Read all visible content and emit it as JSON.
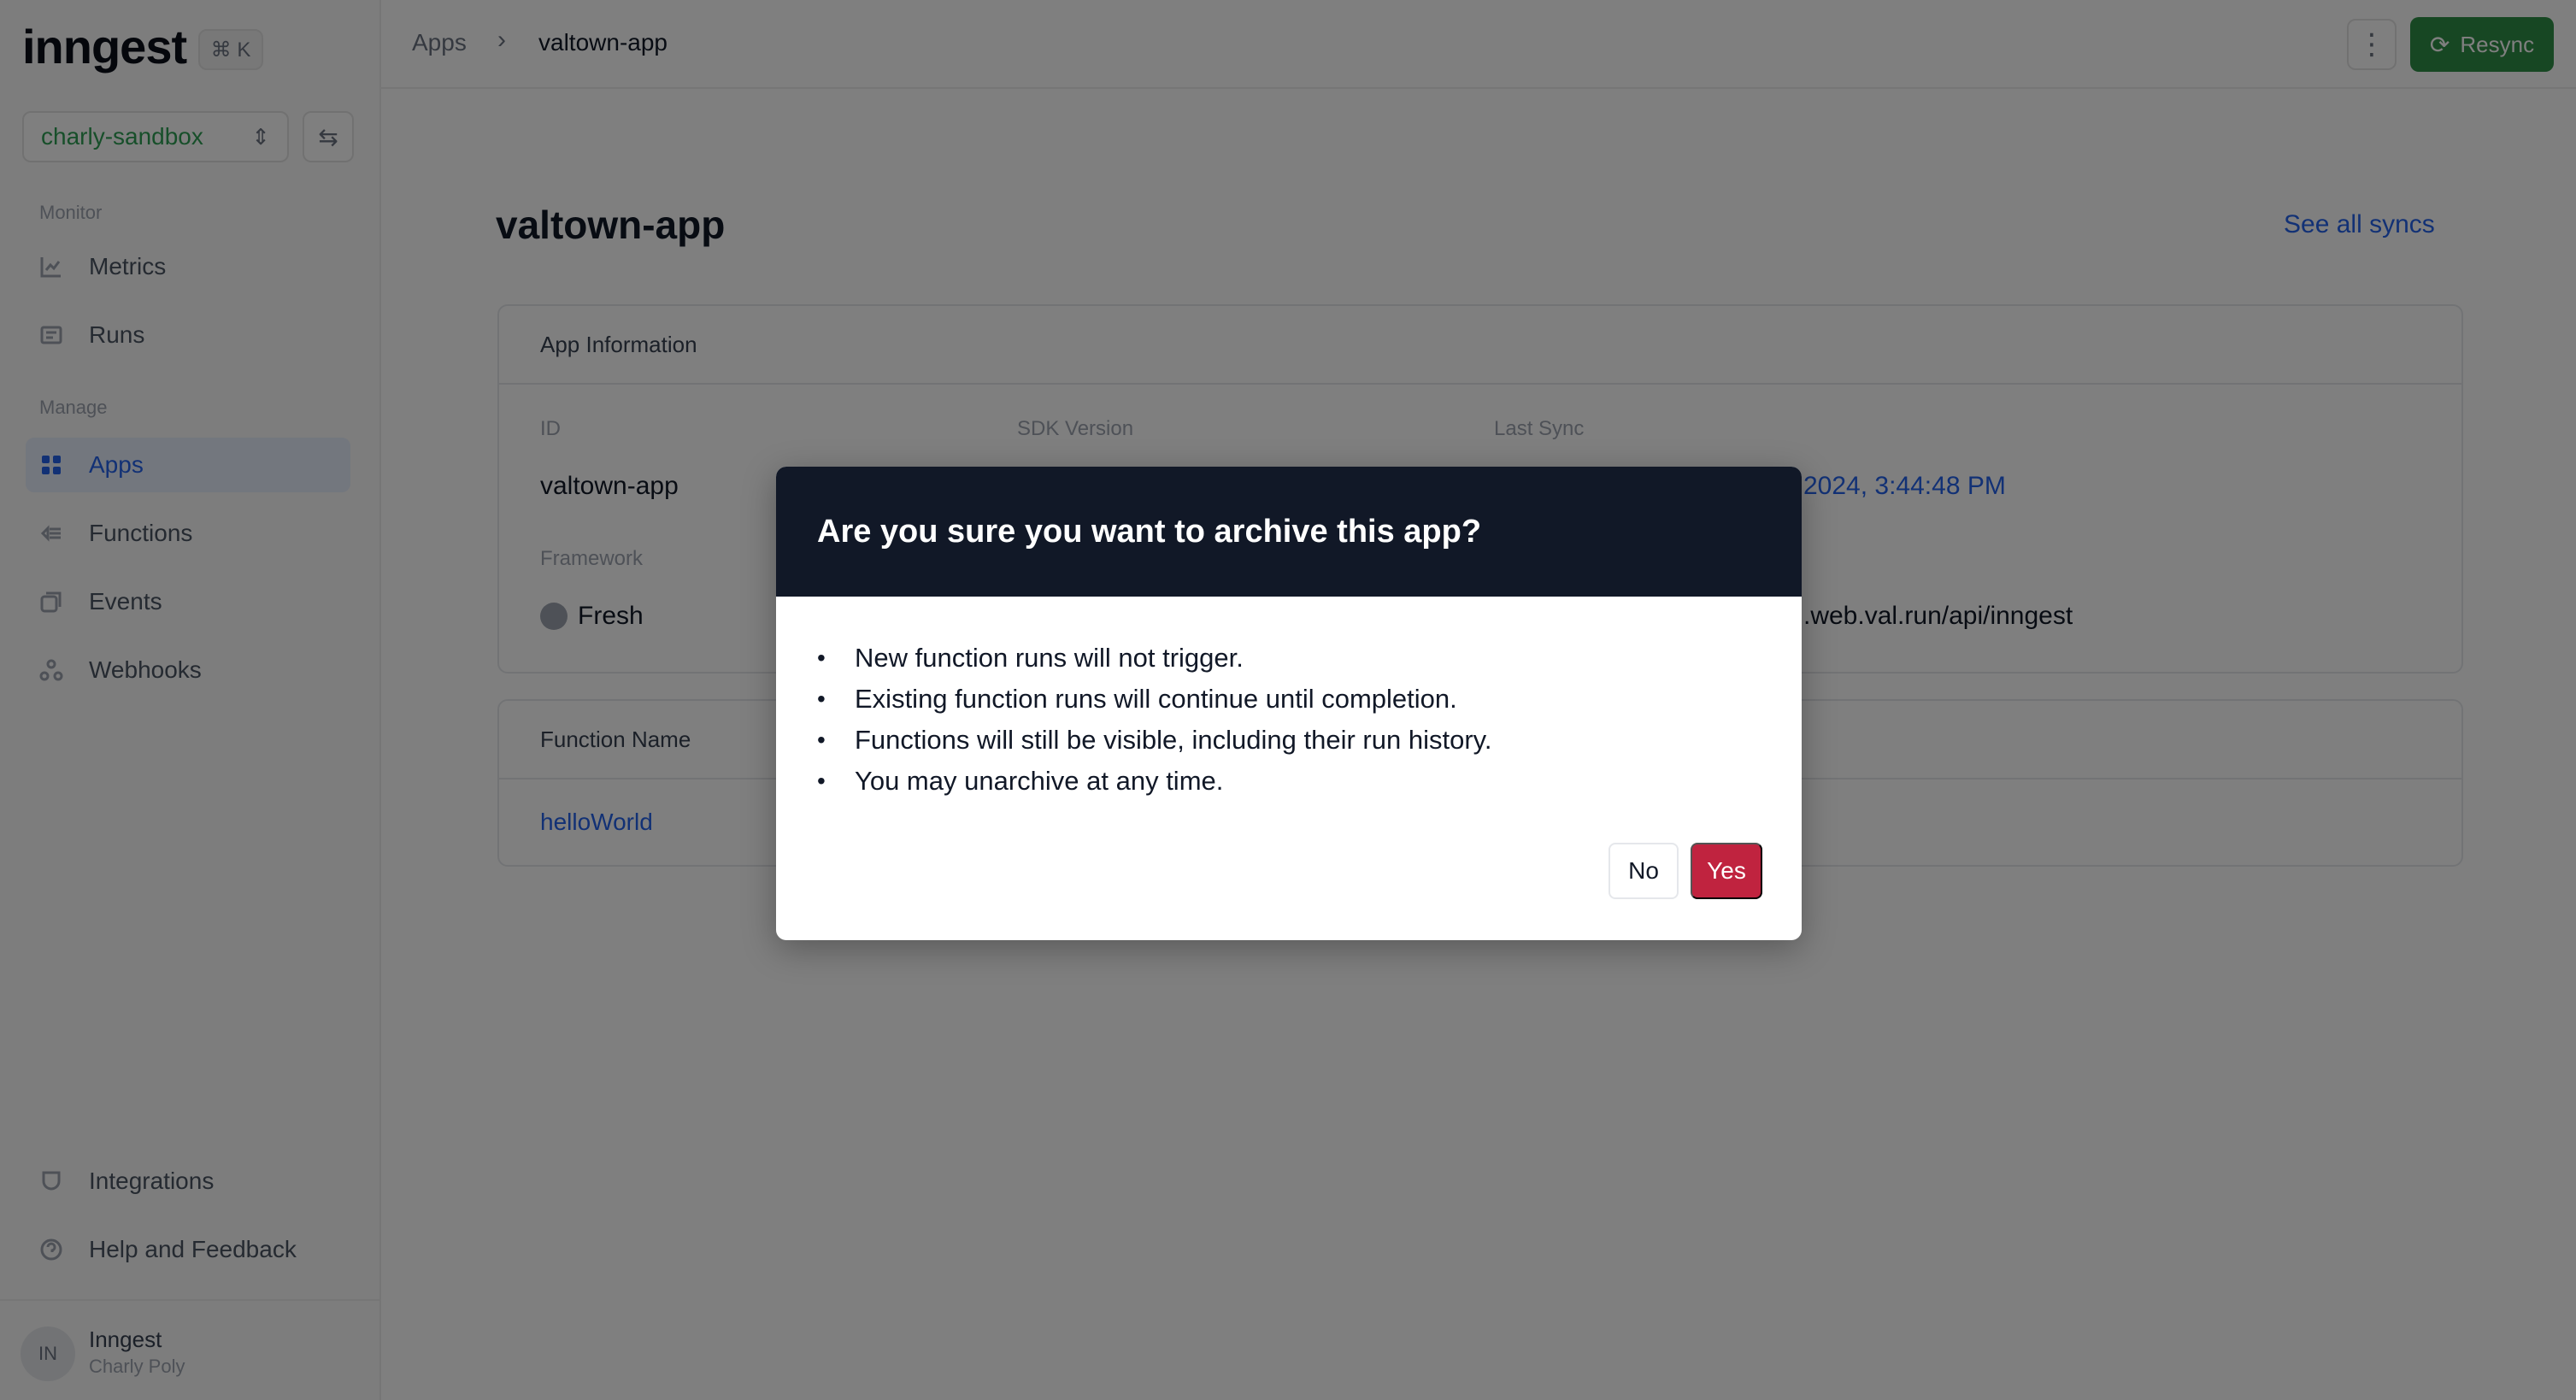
{
  "sidebar": {
    "logo": "inngest",
    "shortcut": "⌘ K",
    "env_select": {
      "value": "charly-sandbox",
      "icon": "chevron-updown-icon"
    },
    "env_switch_icon": "switch-arrows-icon",
    "sections": {
      "monitor": "Monitor",
      "manage": "Manage"
    },
    "monitor_items": [
      {
        "label": "Metrics",
        "icon": "chart-icon"
      },
      {
        "label": "Runs",
        "icon": "list-icon"
      }
    ],
    "manage_items": [
      {
        "label": "Apps",
        "icon": "apps-grid-icon",
        "active": true
      },
      {
        "label": "Functions",
        "icon": "function-icon"
      },
      {
        "label": "Events",
        "icon": "events-icon"
      },
      {
        "label": "Webhooks",
        "icon": "webhook-icon"
      }
    ],
    "bottom_items": [
      {
        "label": "Integrations",
        "icon": "integrations-icon"
      },
      {
        "label": "Help and Feedback",
        "icon": "help-icon"
      }
    ],
    "user": {
      "initials": "IN",
      "org": "Inngest",
      "name": "Charly Poly"
    }
  },
  "topbar": {
    "breadcrumb": [
      "Apps",
      "valtown-app"
    ],
    "resync_label": "Resync"
  },
  "main": {
    "title": "valtown-app",
    "see_all_syncs": "See all syncs",
    "app_info": {
      "heading": "App Information",
      "id_label": "ID",
      "id_value": "valtown-app",
      "sdk_label": "SDK Version",
      "last_sync_label": "Last Sync",
      "last_sync_value_visible": "2024, 3:44:48 PM",
      "framework_label": "Framework",
      "framework_value": "Fresh",
      "url_visible": ".web.val.run/api/inngest"
    },
    "functions_table": {
      "header": "Function Name",
      "rows": [
        "helloWorld"
      ]
    }
  },
  "dialog": {
    "title": "Are you sure you want to archive this app?",
    "points": [
      "New function runs will not trigger.",
      "Existing function runs will continue until completion.",
      "Functions will still be visible, including their run history.",
      "You may unarchive at any time."
    ],
    "no_label": "No",
    "yes_label": "Yes",
    "yes_color": "#c0233f",
    "header_color": "#111827"
  }
}
